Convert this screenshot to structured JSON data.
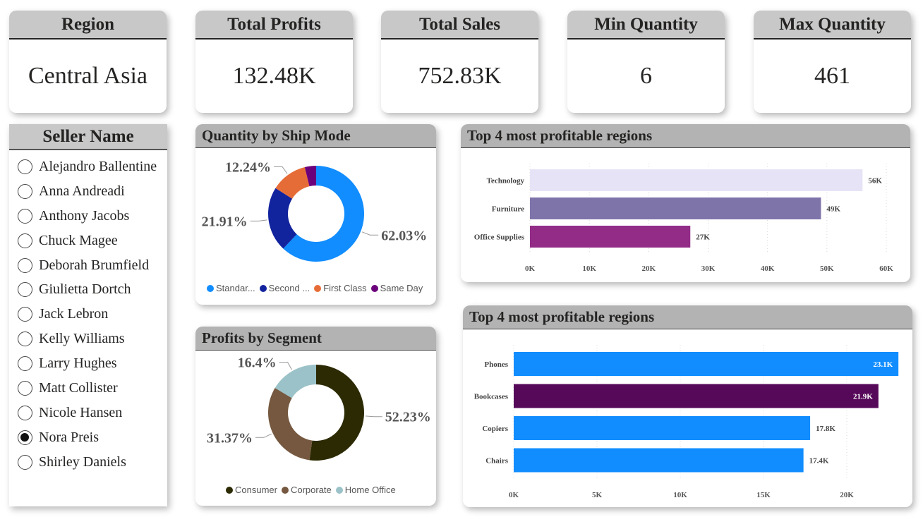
{
  "kpis": [
    {
      "label": "Region",
      "value": "Central Asia"
    },
    {
      "label": "Total Profits",
      "value": "132.48K"
    },
    {
      "label": "Total Sales",
      "value": "752.83K"
    },
    {
      "label": "Min Quantity",
      "value": "6"
    },
    {
      "label": "Max Quantity",
      "value": "461"
    }
  ],
  "seller_slicer": {
    "title": "Seller Name",
    "selected": "Nora Preis",
    "items": [
      "Alejandro Ballentine",
      "Anna Andreadi",
      "Anthony Jacobs",
      "Chuck Magee",
      "Deborah Brumfield",
      "Giulietta Dortch",
      "Jack Lebron",
      "Kelly Williams",
      "Larry Hughes",
      "Matt Collister",
      "Nicole Hansen",
      "Nora Preis",
      "Shirley Daniels"
    ]
  },
  "chart_data": [
    {
      "type": "pie",
      "title": "Quantity by Ship Mode",
      "categories": [
        "Standar...",
        "Second ...",
        "First Class",
        "Same Day"
      ],
      "values": [
        62.03,
        21.91,
        12.24,
        3.82
      ],
      "data_labels": [
        "62.03%",
        "21.91%",
        "12.24%",
        ""
      ],
      "colors": [
        "#118DFF",
        "#12239E",
        "#E66C37",
        "#6B007B"
      ],
      "legend": "bottom"
    },
    {
      "type": "pie",
      "title": "Profits by Segment",
      "categories": [
        "Consumer",
        "Corporate",
        "Home Office"
      ],
      "values": [
        52.23,
        31.37,
        16.4
      ],
      "data_labels": [
        "52.23%",
        "31.37%",
        "16.4%"
      ],
      "colors": [
        "#2B2A03",
        "#75583F",
        "#9BC2C8"
      ],
      "legend": "bottom"
    },
    {
      "type": "bar",
      "orientation": "horizontal",
      "title": "Top 4 most profitable regions",
      "categories": [
        "Technology",
        "Furniture",
        "Office Supplies"
      ],
      "values": [
        56,
        49,
        27
      ],
      "data_labels": [
        "56K",
        "49K",
        "27K"
      ],
      "colors": [
        "#E6E3F7",
        "#7E74AA",
        "#922C87"
      ],
      "xlim": [
        0,
        60
      ],
      "ticks": [
        "0K",
        "10K",
        "20K",
        "30K",
        "40K",
        "50K",
        "60K"
      ],
      "grid": true
    },
    {
      "type": "bar",
      "orientation": "horizontal",
      "title": "Top 4 most profitable regions",
      "categories": [
        "Phones",
        "Bookcases",
        "Copiers",
        "Chairs"
      ],
      "values": [
        23.1,
        21.9,
        17.8,
        17.4
      ],
      "data_labels": [
        "23.1K",
        "21.9K",
        "17.8K",
        "17.4K"
      ],
      "colors": [
        "#118DFF",
        "#560859",
        "#118DFF",
        "#118DFF"
      ],
      "xlim": [
        0,
        25
      ],
      "ticks": [
        "0K",
        "5K",
        "10K",
        "15K",
        "20K"
      ],
      "tick_values": [
        0,
        5,
        10,
        15,
        20
      ],
      "grid": true
    }
  ]
}
